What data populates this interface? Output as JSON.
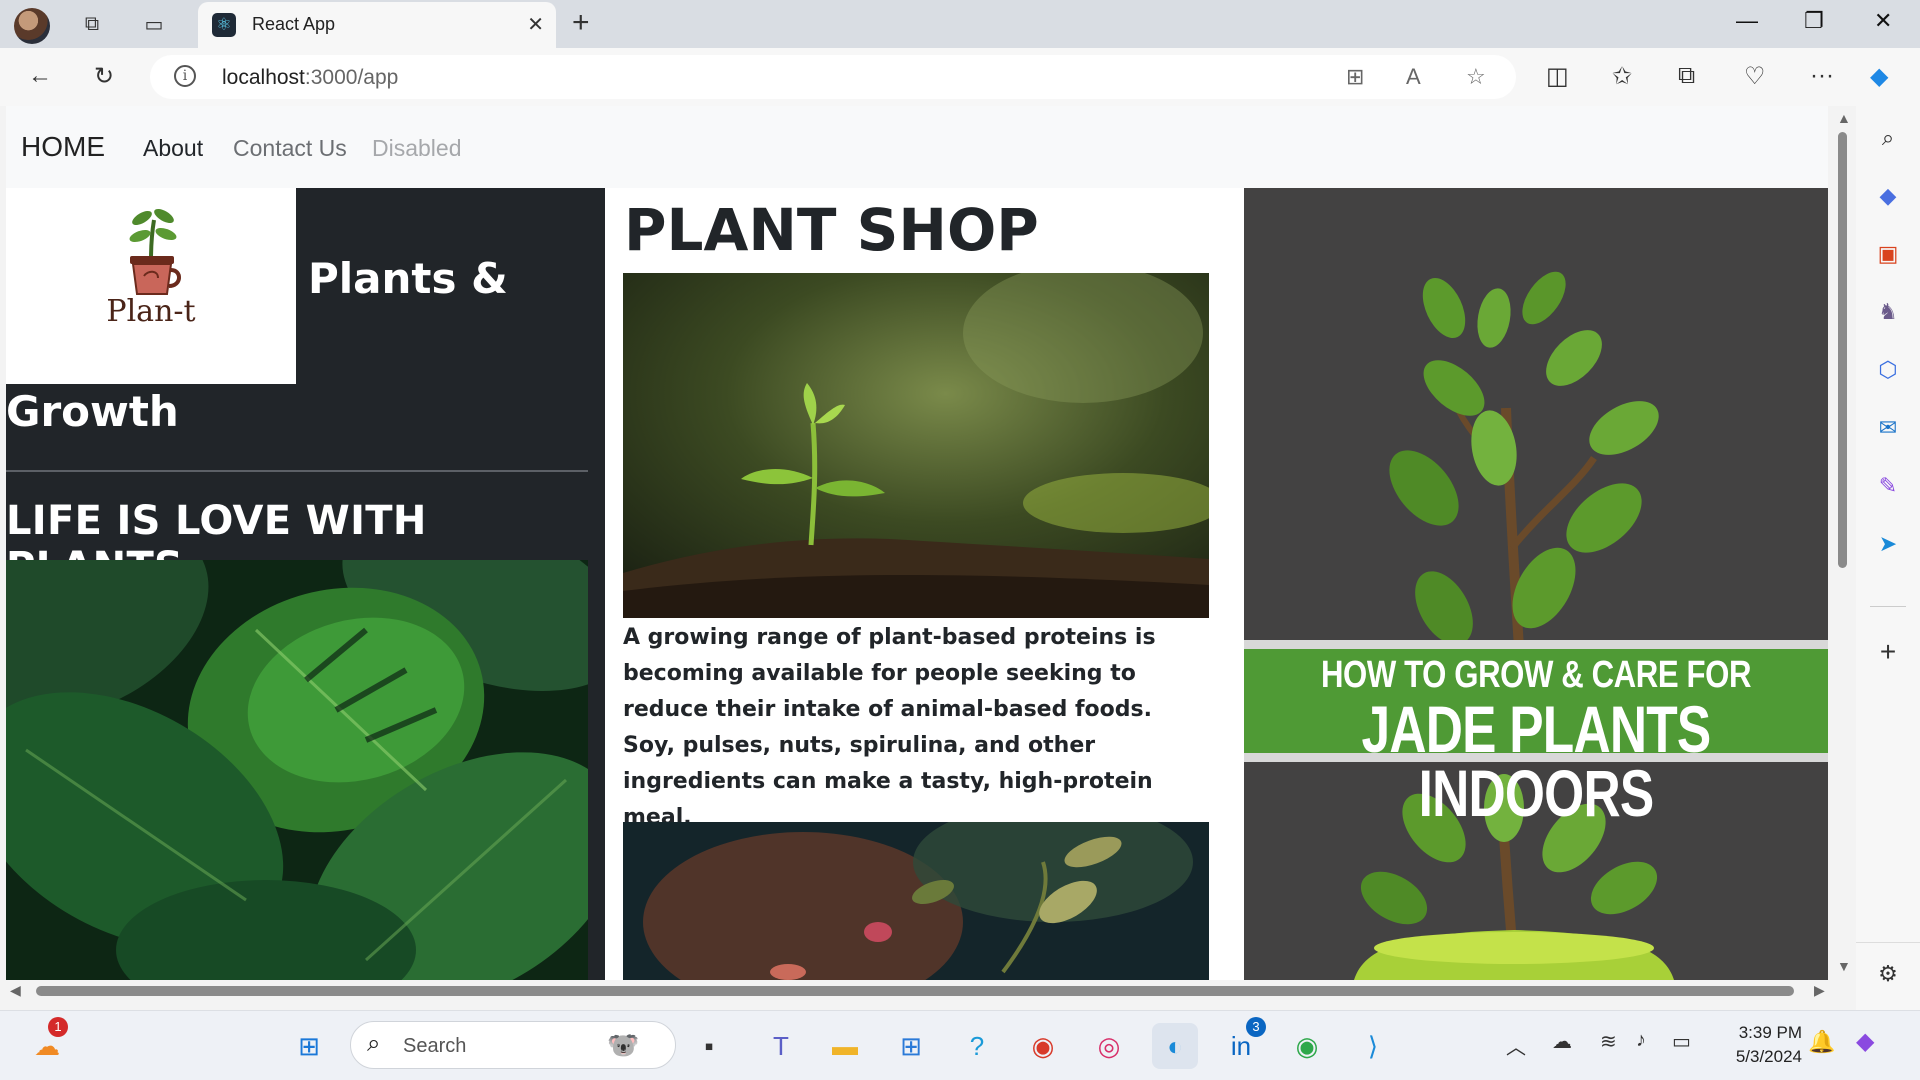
{
  "browser": {
    "tab_title": "React App",
    "url_host": "localhost",
    "url_path": ":3000/app",
    "new_tab_symbol": "+"
  },
  "navbar": {
    "brand": "HOME",
    "links": [
      {
        "label": "About",
        "state": "active"
      },
      {
        "label": "Contact Us",
        "state": "normal"
      },
      {
        "label": "Disabled",
        "state": "disabled"
      }
    ]
  },
  "left_panel": {
    "logo_text": "Plan-t",
    "heading_part1": "Plants &",
    "heading_part2": "Growth",
    "slogan": "LIFE IS LOVE WITH PLANTS"
  },
  "main": {
    "title": "PLANT SHOP",
    "description": "A growing range of plant-based proteins is becoming available for people seeking to reduce their intake of animal-based foods. Soy, pulses, nuts, spirulina, and other ingredients can make a tasty, high-protein meal."
  },
  "right_panel": {
    "banner_line1": "HOW TO GROW & CARE FOR",
    "banner_line2": "JADE PLANTS INDOORS"
  },
  "taskbar": {
    "search_placeholder": "Search",
    "time": "3:39 PM",
    "date": "5/3/2024",
    "widget_badge": "1",
    "linkedin_badge": "3"
  },
  "colors": {
    "dark_panel": "#212529",
    "banner_green": "#4f9a35",
    "nav_bg": "#f8f9fa",
    "disabled_link": "#a6a8ab",
    "muted_link": "#6c6f73"
  }
}
